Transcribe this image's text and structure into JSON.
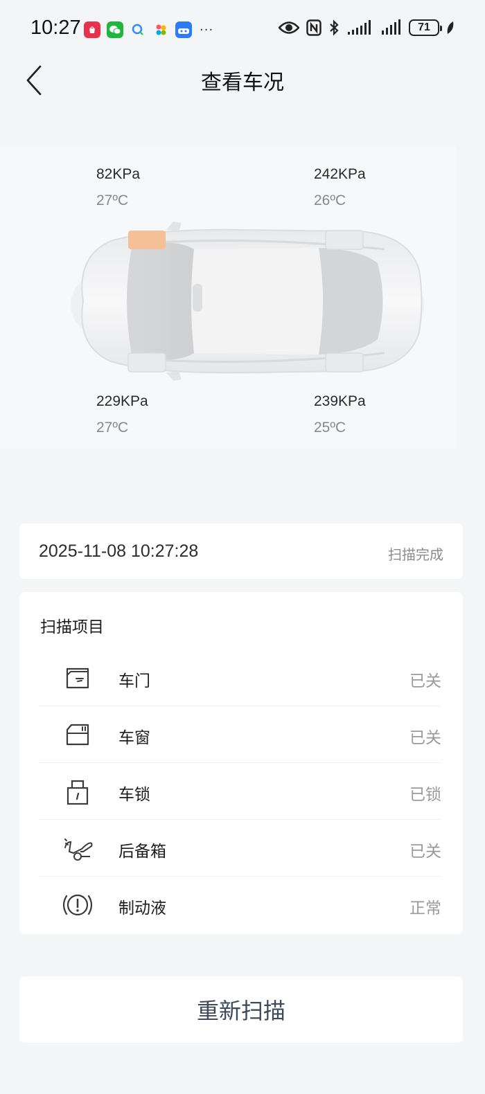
{
  "status_bar": {
    "time": "10:27",
    "battery_level": "71",
    "icons": [
      "huawei-store-icon",
      "wechat-icon",
      "search-app-icon",
      "color-app-icon",
      "auto-home-icon",
      "more-dots-icon",
      "eye-icon",
      "nfc-icon",
      "bluetooth-icon",
      "signal-icon",
      "signal-icon-2",
      "battery-icon",
      "leaf-icon"
    ],
    "more": "···"
  },
  "header": {
    "title": "查看车况"
  },
  "tires": {
    "front_left": {
      "pressure": "82KPa",
      "temp": "27ºC",
      "alert": true
    },
    "front_right": {
      "pressure": "242KPa",
      "temp": "26ºC",
      "alert": false
    },
    "rear_left": {
      "pressure": "229KPa",
      "temp": "27ºC",
      "alert": false
    },
    "rear_right": {
      "pressure": "239KPa",
      "temp": "25ºC",
      "alert": false
    }
  },
  "colors": {
    "tire_alert": "#f5bf97",
    "background": "#f4f5f7",
    "card": "#ffffff",
    "rescan_text": "#3d4a5c"
  },
  "scan_info": {
    "datetime": "2025-11-08 10:27:28",
    "status": "扫描完成"
  },
  "scan_items": {
    "title": "扫描项目",
    "items": [
      {
        "icon": "car-door-icon",
        "label": "车门",
        "status": "已关"
      },
      {
        "icon": "car-window-icon",
        "label": "车窗",
        "status": "已关"
      },
      {
        "icon": "car-lock-icon",
        "label": "车锁",
        "status": "已锁"
      },
      {
        "icon": "trunk-icon",
        "label": "后备箱",
        "status": "已关"
      },
      {
        "icon": "brake-fluid-icon",
        "label": "制动液",
        "status": "正常"
      }
    ]
  },
  "actions": {
    "rescan_label": "重新扫描"
  }
}
